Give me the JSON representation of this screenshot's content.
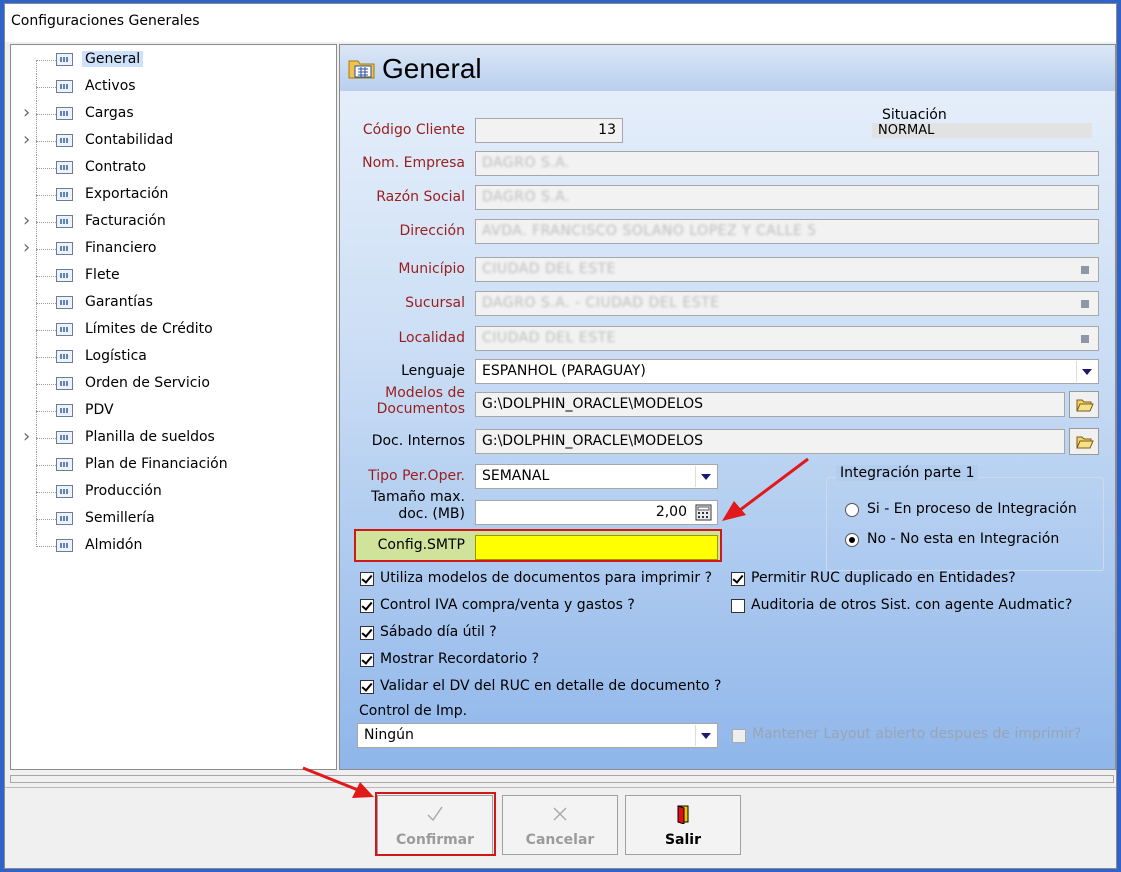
{
  "window": {
    "title": "Configuraciones Generales"
  },
  "tree": {
    "items": [
      {
        "label": "General",
        "expandable": false,
        "selected": true
      },
      {
        "label": "Activos",
        "expandable": false
      },
      {
        "label": "Cargas",
        "expandable": true
      },
      {
        "label": "Contabilidad",
        "expandable": true
      },
      {
        "label": "Contrato",
        "expandable": false
      },
      {
        "label": "Exportación",
        "expandable": false
      },
      {
        "label": "Facturación",
        "expandable": true
      },
      {
        "label": "Financiero",
        "expandable": true
      },
      {
        "label": "Flete",
        "expandable": false
      },
      {
        "label": "Garantías",
        "expandable": false
      },
      {
        "label": "Límites de Crédito",
        "expandable": false
      },
      {
        "label": "Logística",
        "expandable": false
      },
      {
        "label": "Orden de Servicio",
        "expandable": false
      },
      {
        "label": "PDV",
        "expandable": false
      },
      {
        "label": "Planilla de sueldos",
        "expandable": true
      },
      {
        "label": "Plan de Financiación",
        "expandable": false
      },
      {
        "label": "Producción",
        "expandable": false
      },
      {
        "label": "Semillería",
        "expandable": false
      },
      {
        "label": "Almidón",
        "expandable": false
      }
    ]
  },
  "panel": {
    "title": "General",
    "codigo_cliente": {
      "label": "Código Cliente",
      "value": "13"
    },
    "situacion": {
      "label": "Situación",
      "value": "NORMAL"
    },
    "nom_empresa": {
      "label": "Nom. Empresa",
      "value": "DAGRO S.A."
    },
    "razon_social": {
      "label": "Razón Social",
      "value": "DAGRO S.A."
    },
    "direccion": {
      "label": "Dirección",
      "value": "AVDA. FRANCISCO SOLANO LOPEZ Y CALLE 5"
    },
    "municipio": {
      "label": "Município",
      "value": "CIUDAD DEL ESTE"
    },
    "sucursal": {
      "label": "Sucursal",
      "value": "DAGRO S.A. - CIUDAD DEL ESTE"
    },
    "localidad": {
      "label": "Localidad",
      "value": "CIUDAD DEL ESTE"
    },
    "lenguaje": {
      "label": "Lenguaje",
      "value": "ESPANHOL (PARAGUAY)"
    },
    "modelos": {
      "label_line1": "Modelos de",
      "label_line2": "Documentos",
      "value": "G:\\DOLPHIN_ORACLE\\MODELOS"
    },
    "doc_internos": {
      "label": "Doc. Internos",
      "value": "G:\\DOLPHIN_ORACLE\\MODELOS"
    },
    "tipo_per": {
      "label": "Tipo Per.Oper.",
      "value": "SEMANAL"
    },
    "tamano": {
      "label_line1": "Tamaño max.",
      "label_line2": "doc. (MB)",
      "value": "2,00"
    },
    "config_smtp": {
      "label": "Config.SMTP",
      "value": ""
    },
    "integracion": {
      "title": "Integración parte 1",
      "options": [
        {
          "label": "Si - En proceso de Integración",
          "checked": false
        },
        {
          "label": "No - No esta en Integración",
          "checked": true
        }
      ]
    },
    "checks_left": [
      {
        "label": "Utiliza modelos de documentos para imprimir ?",
        "checked": true
      },
      {
        "label": "Control IVA compra/venta y gastos ?",
        "checked": true
      },
      {
        "label": "Sábado día útil ?",
        "checked": true
      },
      {
        "label": "Mostrar Recordatorio ?",
        "checked": true
      },
      {
        "label": "Validar el DV del RUC en detalle de documento ?",
        "checked": true
      }
    ],
    "checks_right": [
      {
        "label": "Permitir RUC duplicado en Entidades?",
        "checked": true
      },
      {
        "label": "Auditoria de otros Sist. con agente Audmatic?",
        "checked": false
      }
    ],
    "control_imp": {
      "label": "Control de Imp.",
      "value": "Ningún"
    },
    "mantener": {
      "label": "Mantener Layout abierto despues de imprimir?",
      "checked": false
    }
  },
  "buttons": {
    "confirmar": {
      "label": "Confirmar",
      "enabled": false
    },
    "cancelar": {
      "label": "Cancelar",
      "enabled": false
    },
    "salir": {
      "label": "Salir",
      "enabled": true
    }
  },
  "colors": {
    "highlight_box": "#d01818",
    "smtp_field": "#ffff00",
    "label_red": "#9a1e1e"
  }
}
